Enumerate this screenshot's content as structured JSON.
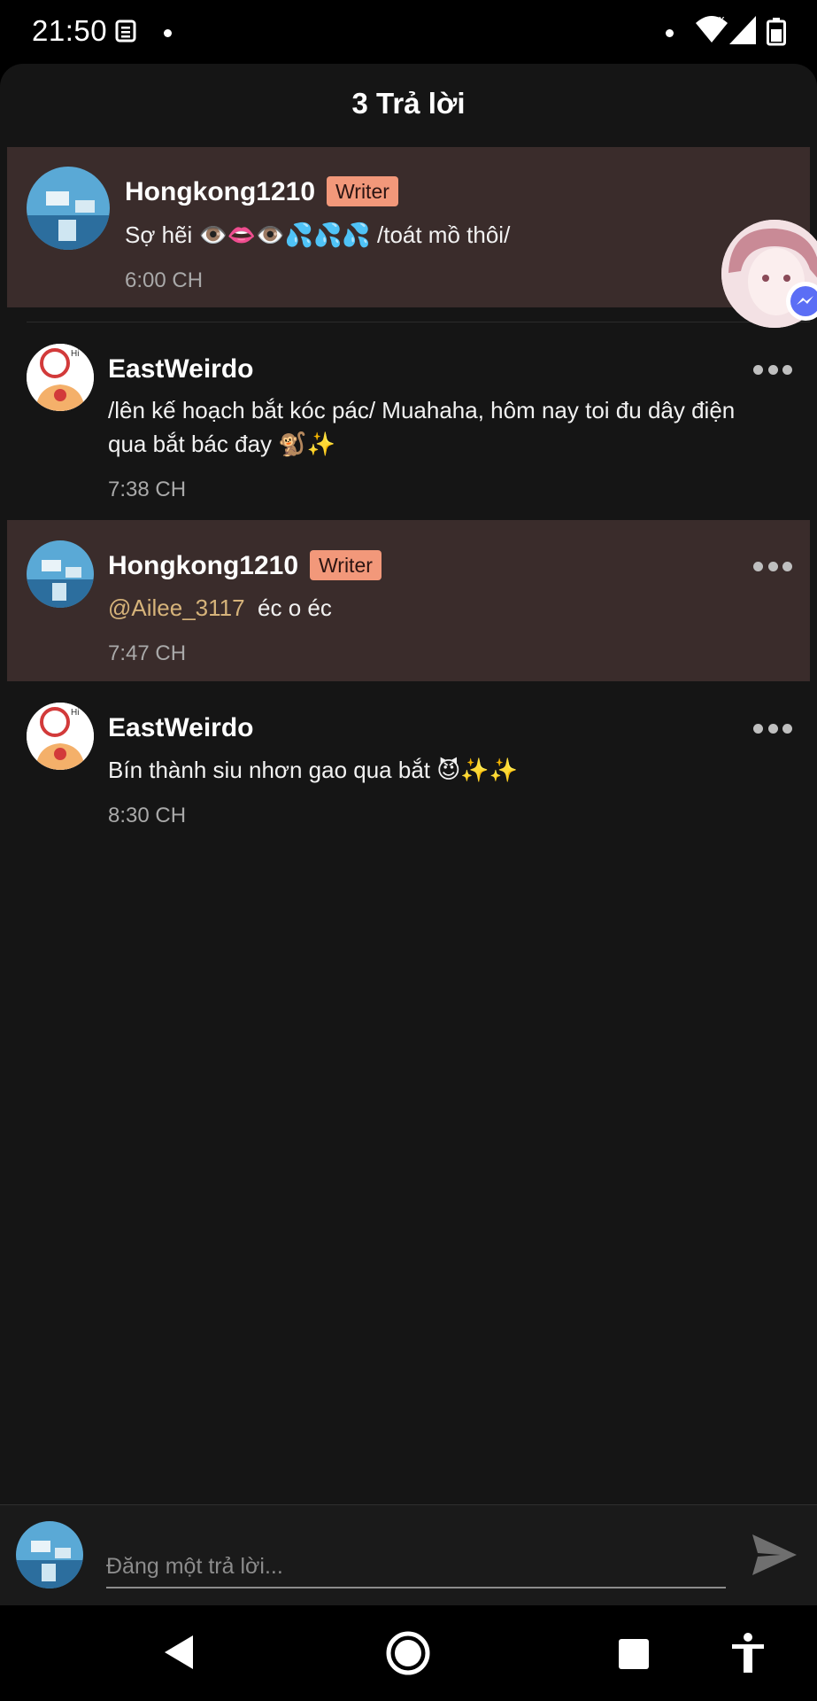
{
  "status": {
    "time": "21:50"
  },
  "sheet": {
    "title": "3 Trả lời"
  },
  "comments": [
    {
      "author": "Hongkong1210",
      "badge": "Writer",
      "text": "Sợ hẽi 👁️👄👁️💦💦💦 /toát mồ thôi/",
      "time": "6:00 CH",
      "highlighted": true
    },
    {
      "author": "EastWeirdo",
      "text_line1": "/lên kế hoạch bắt kóc pác/ Muahaha, hôm nay toi đu dây điện",
      "text_line2": "qua bắt bác đay 🐒✨",
      "time": "7:38 CH"
    },
    {
      "author": "Hongkong1210",
      "badge": "Writer",
      "mention": "@Ailee_3117",
      "text": "éc o éc",
      "time": "7:47 CH",
      "highlighted": true
    },
    {
      "author": "EastWeirdo",
      "text": "Bín thành siu nhơn gao qua bắt 😈✨✨",
      "time": "8:30 CH"
    }
  ],
  "composer": {
    "placeholder": "Đăng một trả lời..."
  },
  "icons": [
    "news-icon",
    "wifi-icon",
    "signal-icon",
    "battery-icon",
    "more-icon",
    "send-icon",
    "back-icon",
    "home-icon",
    "recents-icon",
    "accessibility-icon",
    "messenger-icon"
  ],
  "colors": {
    "background": "#151515",
    "highlight": "#3a2c2b",
    "badge": "#f2987a",
    "mention": "#d6b37a"
  }
}
